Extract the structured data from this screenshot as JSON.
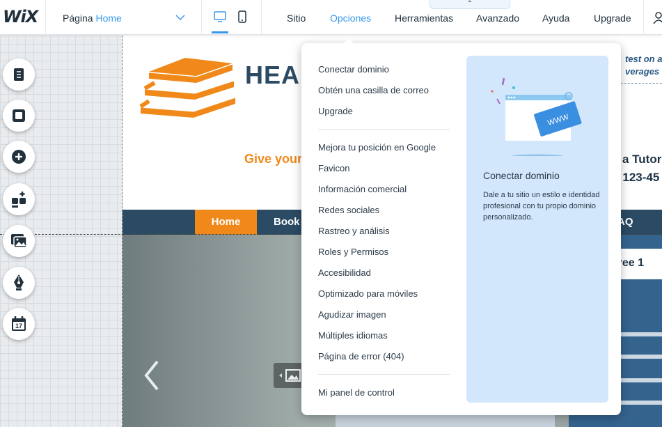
{
  "app": {
    "logo": "WiX"
  },
  "page_selector": {
    "prefix": "Página",
    "page": "Home"
  },
  "menu": {
    "sitio": "Sitio",
    "opciones": "Opciones",
    "herramientas": "Herramientas",
    "avanzado": "Avanzado",
    "ayuda": "Ayuda",
    "upgrade": "Upgrade"
  },
  "collapse_glyph": "⌃",
  "colors": {
    "accent": "#3899ec",
    "orange": "#f0891a",
    "navy": "#2b4a63"
  },
  "tools": [
    "pages-icon",
    "background-icon",
    "add-icon",
    "apps-icon",
    "media-icon",
    "blog-pen-icon",
    "bookings-calendar-icon"
  ],
  "calendar_day": "17",
  "site": {
    "title": "HEA",
    "tagline": "Give your",
    "right_line1": "test on a",
    "right_line2": "verages o",
    "right_big1": "a Tutor",
    "right_big2": ": 123-45",
    "nav": {
      "home": "Home",
      "book": "Book A",
      "faq": "AQ"
    },
    "panel_text": "a free 1"
  },
  "dropdown": {
    "group1": [
      "Conectar dominio",
      "Obtén una casilla de correo",
      "Upgrade"
    ],
    "group2": [
      "Mejora tu posición en Google",
      "Favicon",
      "Información comercial",
      "Redes sociales",
      "Rastreo y análisis",
      "Roles y Permisos",
      "Accesibilidad",
      "Optimizado para móviles",
      "Agudizar imagen",
      "Múltiples idiomas",
      "Página de error (404)"
    ],
    "group3": [
      "Mi panel de control"
    ],
    "promo": {
      "badge": "WWW",
      "title": "Conectar dominio",
      "description": "Dale a tu sitio un estilo e identidad profesional con tu propio dominio personalizado."
    }
  }
}
